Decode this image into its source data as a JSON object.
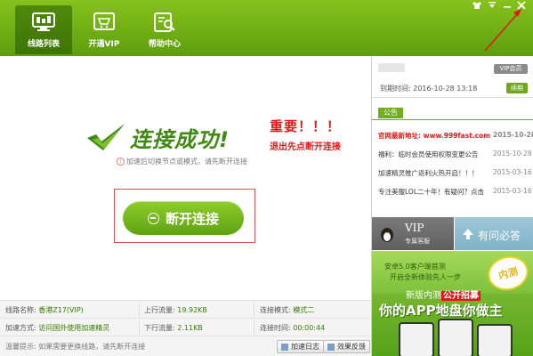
{
  "tabs": [
    {
      "label": "线路列表",
      "icon": "monitor-icon",
      "active": true
    },
    {
      "label": "开通VIP",
      "icon": "cart-icon",
      "active": false
    },
    {
      "label": "帮助中心",
      "icon": "search-doc-icon",
      "active": false
    }
  ],
  "window_controls": {
    "skin": "skin-icon",
    "menu": "menu-icon",
    "minimize": "minimize-icon",
    "close": "close-icon"
  },
  "status": {
    "title": "连接成功!",
    "tip": "加速后切换节点或模式，请先断开连接",
    "disconnect_label": "断开连接"
  },
  "annotation": {
    "line1": "重要！！！",
    "line2": "退出先点断开连接"
  },
  "info": {
    "line_label": "线路名称:",
    "line_value": "香港Z17(VIP)",
    "up_label": "上行流量:",
    "up_value": "19.92KB",
    "mode_label": "连接模式:",
    "mode_value": "模式二",
    "method_label": "加速方式:",
    "method_value": "访问国外使用加速精灵",
    "down_label": "下行流量:",
    "down_value": "2.11KB",
    "time_label": "连接时间:",
    "time_value": "00:00:44",
    "hint": "温馨提示: 如果需要更换线路，请先断开连接",
    "log_button": "加速日志",
    "feedback_button": "效果反馈"
  },
  "account": {
    "vip_badge": "VIP会员",
    "expiry_label": "到期时间:",
    "expiry_value": "2016-10-28 13:18",
    "renew": "续期"
  },
  "notices": {
    "tag": "公告",
    "items": [
      {
        "text": "官网最新地址: www.999fast.com",
        "date": "2015-10-28",
        "highlight": true
      },
      {
        "text": "福利：临时会员使用权限变更公告",
        "date": "2015-10-28",
        "highlight": false
      },
      {
        "text": "加速精灵推广返利火热开启！！！",
        "date": "2015-03-16",
        "highlight": false
      },
      {
        "text": "专注美服LOL二十年！有疑问？点击",
        "date": "2015-03-16",
        "highlight": false
      }
    ]
  },
  "promos": {
    "vip_title": "VIP",
    "vip_sub": "专属客服",
    "faq": "有问必答"
  },
  "banner": {
    "line1": "安卓5.0客户端首测",
    "line2": "开启全新体验先人一步",
    "line3": "新版内测",
    "line4": "公开招募",
    "line5": "你的APP地盘你做主",
    "stamp": "内测"
  },
  "colors": {
    "brand_green": "#6aa81a",
    "alert_red": "#e21818"
  }
}
